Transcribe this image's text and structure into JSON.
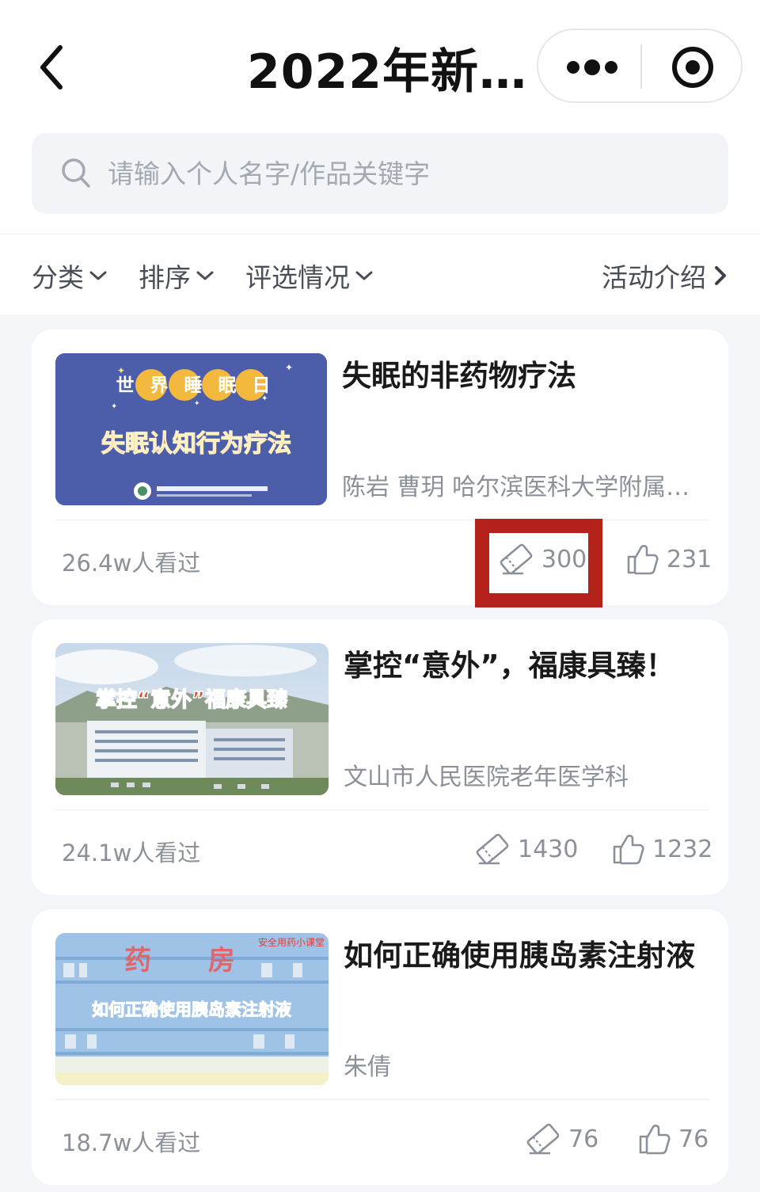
{
  "header": {
    "title": "2022年新…",
    "back_icon": "chevron-left-icon",
    "more_icon": "more-dots-icon",
    "close_icon": "target-circle-icon"
  },
  "search": {
    "placeholder": "请输入个人名字/作品关键字",
    "value": ""
  },
  "filters": {
    "category": "分类",
    "sort": "排序",
    "selection": "评选情况",
    "activity_intro": "活动介绍"
  },
  "colors": {
    "highlight_box": "#b5211b",
    "page_background": "#f3f5f8",
    "muted_text": "#8b9099"
  },
  "cards": [
    {
      "title": "失眠的非药物疗法",
      "author": "陈岩 曹玥 哈尔滨医科大学附属…",
      "views": "26.4w人看过",
      "tickets": "300",
      "likes": "231",
      "thumb_caption_top": "世界睡眠日",
      "thumb_caption_main": "失眠认知行为疗法",
      "tickets_highlighted": true
    },
    {
      "title": "掌控“意外”，福康具臻！",
      "author": "文山市人民医院老年医学科",
      "views": "24.1w人看过",
      "tickets": "1430",
      "likes": "1232",
      "thumb_caption_main": "掌控“意外”福康具臻"
    },
    {
      "title": "如何正确使用胰岛素注射液",
      "author": "朱倩",
      "views": "18.7w人看过",
      "tickets": "76",
      "likes": "76",
      "thumb_caption_top": "药 房",
      "thumb_caption_corner": "安全用药小课堂",
      "thumb_caption_main": "如何正确使用胰岛素注射液"
    }
  ]
}
